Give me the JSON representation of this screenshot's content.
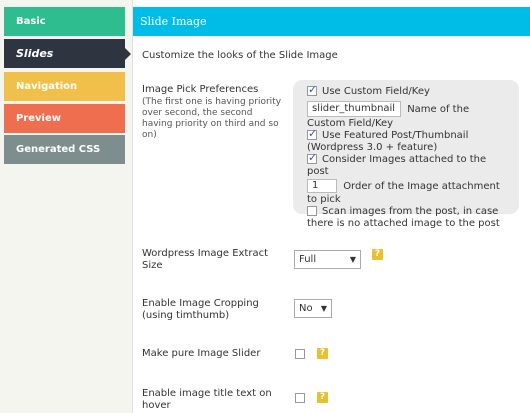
{
  "sidebar": {
    "tabs": [
      {
        "label": "Basic",
        "color": "#2ebd8f"
      },
      {
        "label": "Slides",
        "color": "#2e3440"
      },
      {
        "label": "Navigation",
        "color": "#f0c04a"
      },
      {
        "label": "Preview",
        "color": "#f06e50"
      },
      {
        "label": "Generated CSS",
        "color": "#7e8e8e"
      }
    ]
  },
  "header": {
    "title": "Slide Image"
  },
  "description": "Customize the looks of the Slide Image",
  "image_pick": {
    "label": "Image Pick Preferences",
    "subtext": "(The first one is having priority over second, the second having priority on third and so on)",
    "custom_field": {
      "checked": true,
      "label": "Use Custom Field/Key",
      "value": "slider_thumbnail",
      "after": "Name of the",
      "after2": "Custom Field/Key"
    },
    "featured_post": {
      "checked": true,
      "label": "Use Featured Post/Thumbnail",
      "note": "(Wordpress 3.0 + feature)"
    },
    "attached": {
      "checked": true,
      "label": "Consider Images attached to the post",
      "order_value": "1",
      "order_label": "Order of the Image attachment",
      "order_label2": "to pick"
    },
    "scan": {
      "checked": false,
      "label": "Scan images from the post, in case",
      "label2": "there is no attached image to the post"
    }
  },
  "extract_size": {
    "label_line1": "Wordpress Image Extract",
    "label_line2": "Size",
    "value": "Full",
    "help": "?"
  },
  "cropping": {
    "label_line1": "Enable Image Cropping",
    "label_line2": "(using timthumb)",
    "value": "No",
    "help": "?"
  },
  "pure_slider": {
    "label": "Make pure Image Slider",
    "checked": false,
    "help": "?"
  },
  "title_hover": {
    "label_line1": "Enable image title text on",
    "label_line2": "hover",
    "checked": false,
    "help": "?"
  }
}
